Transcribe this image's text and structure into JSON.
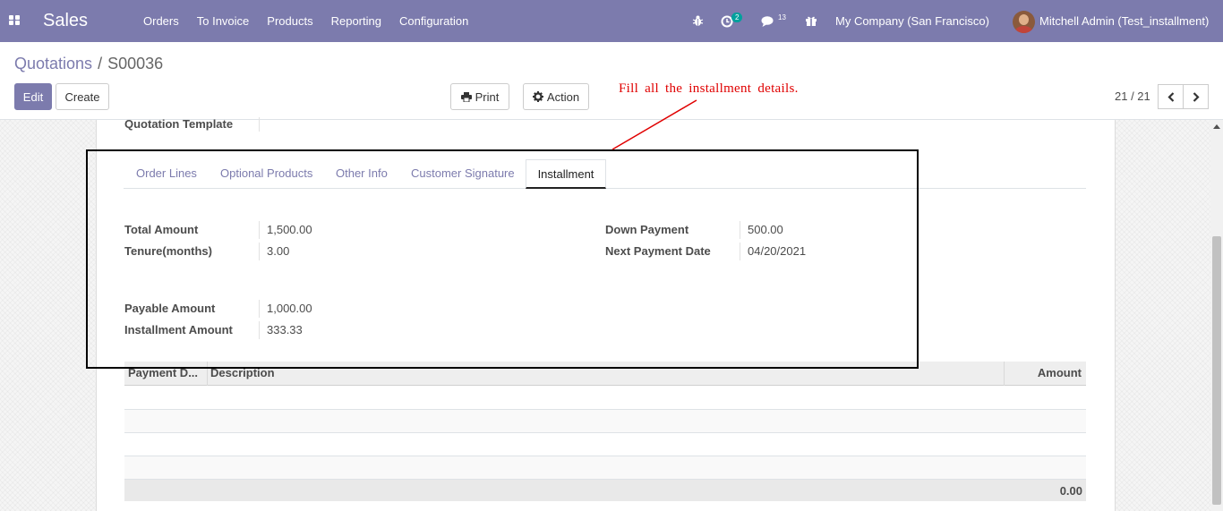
{
  "navbar": {
    "app_name": "Sales",
    "menu": [
      "Orders",
      "To Invoice",
      "Products",
      "Reporting",
      "Configuration"
    ],
    "activity_badge": "2",
    "messages_badge": "13",
    "company": "My Company (San Francisco)",
    "user": "Mitchell Admin (Test_installment)",
    "colors": {
      "brand": "#7c7bad",
      "badge": "#00a09d"
    },
    "icons": [
      "apps-icon",
      "bug-icon",
      "activity-clock-icon",
      "chat-icon",
      "gift-icon",
      "avatar"
    ]
  },
  "control_panel": {
    "breadcrumb_parent": "Quotations",
    "breadcrumb_sep": "/",
    "breadcrumb_current": "S00036",
    "edit_label": "Edit",
    "create_label": "Create",
    "print_label": "Print",
    "action_label": "Action",
    "pager": "21 / 21"
  },
  "form": {
    "quotation_template_label": "Quotation Template",
    "tabs": [
      "Order Lines",
      "Optional Products",
      "Other Info",
      "Customer Signature",
      "Installment"
    ],
    "active_tab": "Installment",
    "fields": {
      "total_amount_label": "Total Amount",
      "total_amount": "1,500.00",
      "tenure_label": "Tenure(months)",
      "tenure": "3.00",
      "down_payment_label": "Down Payment",
      "down_payment": "500.00",
      "next_payment_date_label": "Next Payment Date",
      "next_payment_date": "04/20/2021",
      "payable_amount_label": "Payable Amount",
      "payable_amount": "1,000.00",
      "installment_amount_label": "Installment Amount",
      "installment_amount": "333.33"
    },
    "table": {
      "columns": [
        "Payment D...",
        "Description",
        "Amount"
      ],
      "rows": [],
      "total": "0.00"
    }
  },
  "annotation": {
    "text": "Fill all the installment details.",
    "color": "#e00000"
  }
}
